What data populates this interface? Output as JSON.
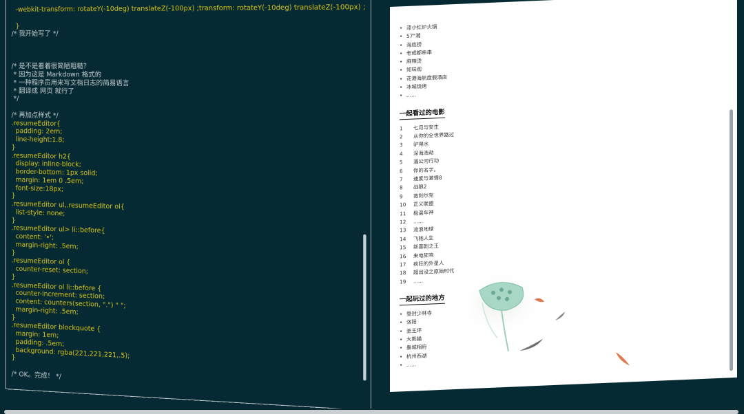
{
  "code_lines": [
    {
      "t": "  -webkit-transform: rotateY(-10deg) translateZ(-100px) ;transform: rotateY(-10deg) translateZ(-100px) ;",
      "c": "tk-prop"
    },
    {
      "t": "",
      "c": ""
    },
    {
      "t": "  }",
      "c": "tk-br"
    },
    {
      "t": "/* 我开始写了 */",
      "c": "tk-com"
    },
    {
      "t": "",
      "c": ""
    },
    {
      "t": "",
      "c": ""
    },
    {
      "t": "",
      "c": ""
    },
    {
      "t": "/* 是不是看着很简陋粗糙？",
      "c": "tk-com"
    },
    {
      "t": " * 因为这是 Markdown 格式的",
      "c": "tk-com"
    },
    {
      "t": " * 一种程序员用来写文档日志的简易语言",
      "c": "tk-com"
    },
    {
      "t": " * 翻译成 网页 就行了",
      "c": "tk-com"
    },
    {
      "t": " */",
      "c": "tk-com"
    },
    {
      "t": "",
      "c": ""
    },
    {
      "t": "/* 再加点样式 */",
      "c": "tk-com"
    },
    {
      "t": ".resumeEditor{",
      "c": "tk-sel"
    },
    {
      "t": "  padding: 2em;",
      "c": "tk-prop"
    },
    {
      "t": "  line-height:1.8;",
      "c": "tk-prop"
    },
    {
      "t": "}",
      "c": "tk-br"
    },
    {
      "t": ".resumeEditor h2{",
      "c": "tk-sel"
    },
    {
      "t": "  display: inline-block;",
      "c": "tk-prop"
    },
    {
      "t": "  border-bottom: 1px solid;",
      "c": "tk-prop"
    },
    {
      "t": "  margin: 1em 0 .5em;",
      "c": "tk-prop"
    },
    {
      "t": "  font-size:18px;",
      "c": "tk-prop"
    },
    {
      "t": "}",
      "c": "tk-br"
    },
    {
      "t": ".resumeEditor ul,.resumeEditor ol{",
      "c": "tk-sel"
    },
    {
      "t": "  list-style: none;",
      "c": "tk-prop"
    },
    {
      "t": "}",
      "c": "tk-br"
    },
    {
      "t": ".resumeEditor ul> li::before{",
      "c": "tk-sel"
    },
    {
      "t": "  content: '•';",
      "c": "tk-prop"
    },
    {
      "t": "  margin-right: .5em;",
      "c": "tk-prop"
    },
    {
      "t": "}",
      "c": "tk-br"
    },
    {
      "t": ".resumeEditor ol {",
      "c": "tk-sel"
    },
    {
      "t": "  counter-reset: section;",
      "c": "tk-prop"
    },
    {
      "t": "}",
      "c": "tk-br"
    },
    {
      "t": ".resumeEditor ol li::before {",
      "c": "tk-sel"
    },
    {
      "t": "  counter-increment: section;",
      "c": "tk-prop"
    },
    {
      "t": "  content: counters(section, \".\") \" \";",
      "c": "tk-prop"
    },
    {
      "t": "  margin-right: .5em;",
      "c": "tk-prop"
    },
    {
      "t": "}",
      "c": "tk-br"
    },
    {
      "t": ".resumeEditor blockquote {",
      "c": "tk-sel"
    },
    {
      "t": "  margin: 1em;",
      "c": "tk-prop"
    },
    {
      "t": "  padding: .5em;",
      "c": "tk-prop"
    },
    {
      "t": "  background: rgba(221,221,221,.5);",
      "c": "tk-prop"
    },
    {
      "t": "}",
      "c": "tk-br"
    },
    {
      "t": "",
      "c": ""
    },
    {
      "t": "/* OK。完成！ */",
      "c": "tk-com"
    }
  ],
  "resume": {
    "food_list": [
      "漆小红炉火锅",
      "57°湘",
      "海底捞",
      "老成都串串",
      "麻辣烫",
      "知味观",
      "花港海航度假酒店",
      "冰城烧烤",
      "......"
    ],
    "movies_heading": "一起看过的电影",
    "movies": [
      "七月与安生",
      "从你的全世界路过",
      "驴得水",
      "深海浩劫",
      "湄公河行动",
      "你的名字。",
      "速度与激情8",
      "战狼2",
      "敦刻尔克",
      "正义联盟",
      "极盗车神",
      "......",
      "流浪地球",
      "飞驰人生",
      "新喜剧之王",
      "来电狂响",
      "疯狂的外星人",
      "超出没之原始时代",
      "......"
    ],
    "places_heading": "一起玩过的地方",
    "places": [
      "登封少林寺",
      "洛阳",
      "圣王坪",
      "大熊猫",
      "墨城相府",
      "杭州西湖",
      "......"
    ]
  }
}
